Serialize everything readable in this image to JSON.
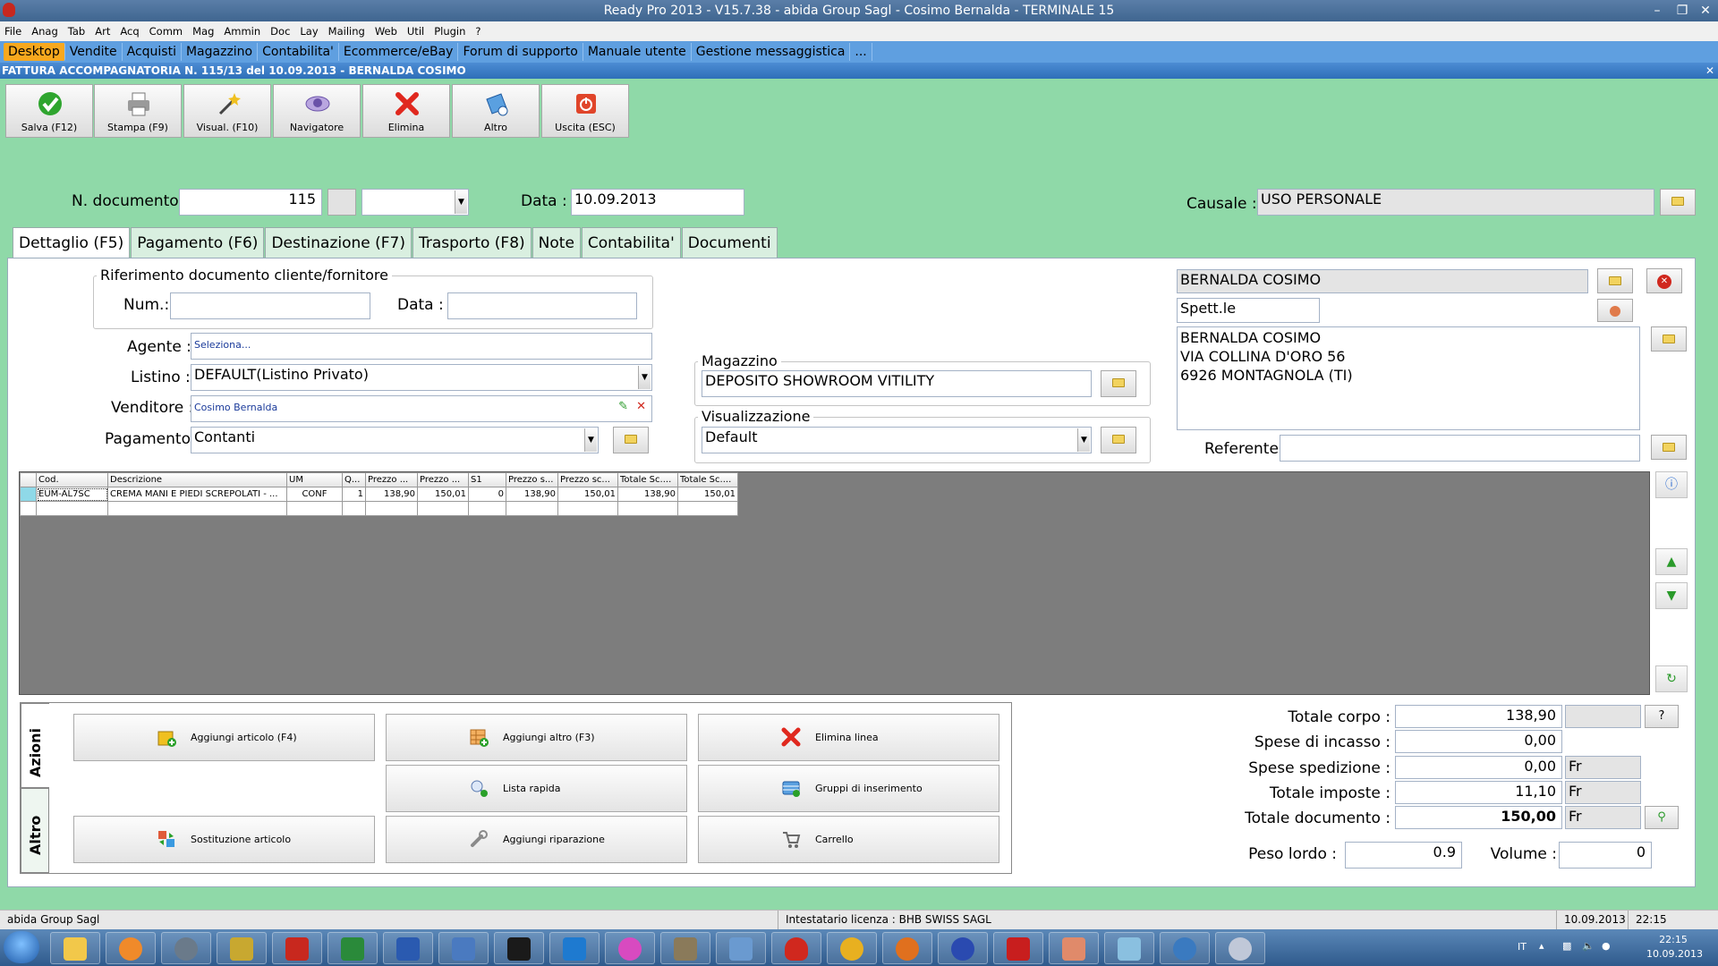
{
  "window": {
    "title": "Ready Pro 2013 - V15.7.38 - abida Group Sagl - Cosimo Bernalda - TERMINALE 15"
  },
  "menu": [
    "File",
    "Anag",
    "Tab",
    "Art",
    "Acq",
    "Comm",
    "Mag",
    "Ammin",
    "Doc",
    "Lay",
    "Mailing",
    "Web",
    "Util",
    "Plugin",
    "?"
  ],
  "main_tabs": [
    "Desktop",
    "Vendite",
    "Acquisti",
    "Magazzino",
    "Contabilita'",
    "Ecommerce/eBay",
    "Forum di supporto",
    "Manuale utente",
    "Gestione messaggistica",
    "..."
  ],
  "document_header": "FATTURA ACCOMPAGNATORIA N. 115/13 del 10.09.2013 - BERNALDA COSIMO",
  "toolbar": [
    {
      "label": "Salva (F12)",
      "icon": "check-icon"
    },
    {
      "label": "Stampa (F9)",
      "icon": "printer-icon"
    },
    {
      "label": "Visual. (F10)",
      "icon": "magic-wand-icon"
    },
    {
      "label": "Navigatore",
      "icon": "navigator-icon"
    },
    {
      "label": "Elimina",
      "icon": "delete-x-icon"
    },
    {
      "label": "Altro",
      "icon": "more-icon"
    },
    {
      "label": "Uscita (ESC)",
      "icon": "exit-icon"
    }
  ],
  "doc": {
    "number_label": "N. documento :",
    "number_value": "115",
    "date_label": "Data :",
    "date_value": "10.09.2013",
    "causale_label": "Causale :",
    "causale_value": "USO PERSONALE"
  },
  "subtabs": [
    "Dettaglio (F5)",
    "Pagamento (F6)",
    "Destinazione (F7)",
    "Trasporto (F8)",
    "Note",
    "Contabilita'",
    "Documenti"
  ],
  "reference": {
    "title": "Riferimento documento cliente/fornitore",
    "num_label": "Num.:",
    "data_label": "Data :"
  },
  "form": {
    "agente_label": "Agente :",
    "agente_value": "Seleziona...",
    "listino_label": "Listino :",
    "listino_value": "DEFAULT(Listino Privato)",
    "venditore_label": "Venditore :",
    "venditore_value": "Cosimo Bernalda",
    "pagamento_label": "Pagamento :",
    "pagamento_value": "Contanti"
  },
  "magazzino": {
    "title": "Magazzino",
    "value": "DEPOSITO SHOWROOM VITILITY"
  },
  "visualizzazione": {
    "title": "Visualizzazione",
    "value": "Default"
  },
  "customer": {
    "name": "BERNALDA COSIMO",
    "salutation": "Spett.le",
    "address_lines": [
      "BERNALDA COSIMO",
      "VIA COLLINA D'ORO 56",
      "6926 MONTAGNOLA (TI)"
    ],
    "referente_label": "Referente"
  },
  "grid": {
    "columns": [
      "Cod.",
      "Descrizione",
      "UM",
      "Q...",
      "Prezzo ...",
      "Prezzo ...",
      "S1",
      "Prezzo s...",
      "Prezzo sc...",
      "Totale Sc....",
      "Totale Sc...."
    ],
    "rows": [
      [
        "EUM-AL7SC",
        "CREMA MANI E PIEDI SCREPOLATI - ...",
        "CONF",
        "1",
        "138,90",
        "150,01",
        "0",
        "138,90",
        "150,01",
        "138,90",
        "150,01"
      ]
    ]
  },
  "actions": {
    "side_tabs": [
      "Azioni",
      "Altro"
    ],
    "buttons": [
      {
        "label": "Aggiungi articolo (F4)",
        "icon": "add-article-icon"
      },
      {
        "label": "Aggiungi altro (F3)",
        "icon": "add-other-icon"
      },
      {
        "label": "Elimina linea",
        "icon": "delete-line-icon"
      },
      {
        "label": "Lista rapida",
        "icon": "quick-list-icon"
      },
      {
        "label": "Gruppi di inserimento",
        "icon": "insert-groups-icon"
      },
      {
        "label": "Sostituzione articolo",
        "icon": "replace-article-icon"
      },
      {
        "label": "Aggiungi riparazione",
        "icon": "repair-icon"
      },
      {
        "label": "Carrello",
        "icon": "cart-icon"
      }
    ]
  },
  "totals": {
    "corpo_label": "Totale corpo :",
    "corpo_value": "138,90",
    "incasso_label": "Spese di incasso :",
    "incasso_value": "0,00",
    "spedizione_label": "Spese spedizione :",
    "spedizione_value": "0,00",
    "imposte_label": "Totale imposte :",
    "imposte_value": "11,10",
    "documento_label": "Totale documento :",
    "documento_value": "150,00",
    "currency": "Fr",
    "question": "?",
    "peso_label": "Peso lordo :",
    "peso_value": "0.9",
    "volume_label": "Volume :",
    "volume_value": "0"
  },
  "status": {
    "company": "abida Group Sagl",
    "license": "Intestatario licenza : BHB SWISS SAGL",
    "date": "10.09.2013",
    "time": "22:15"
  },
  "taskbar": {
    "lang": "IT",
    "clock_time": "22:15",
    "clock_date": "10.09.2013"
  }
}
